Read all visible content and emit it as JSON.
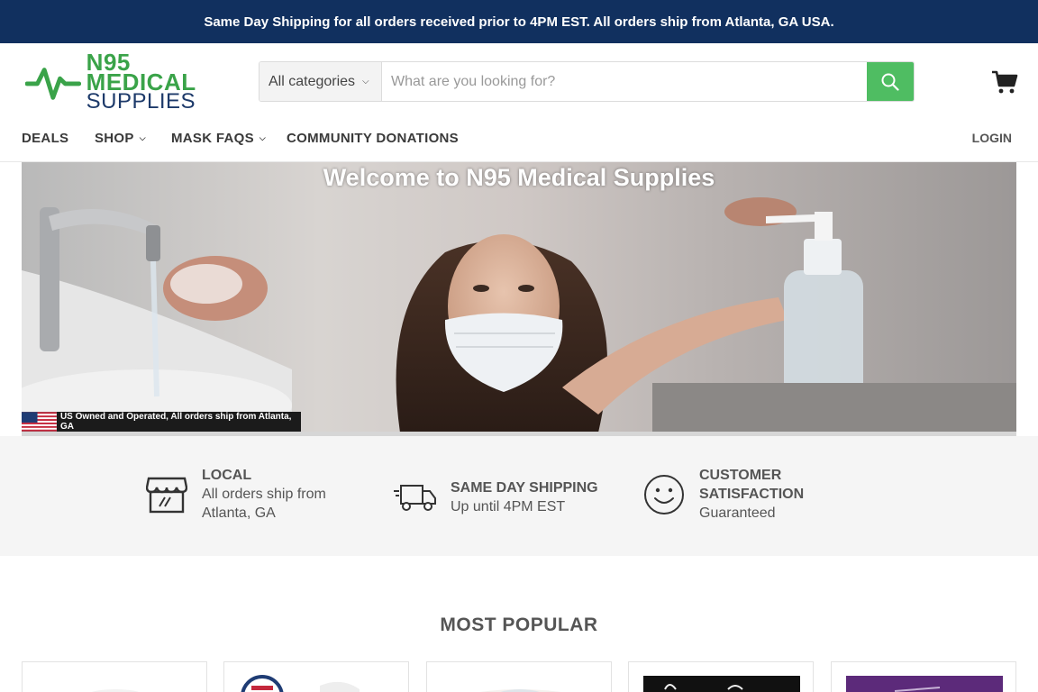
{
  "announcement": "Same Day Shipping for all orders received prior to 4PM EST. All orders ship from Atlanta, GA USA.",
  "logo": {
    "line1": "N95 MEDICAL",
    "line2": "SUPPLIES"
  },
  "search": {
    "category": "All categories",
    "placeholder": "What are you looking for?"
  },
  "nav": {
    "items": [
      {
        "label": "DEALS",
        "has_dropdown": false
      },
      {
        "label": "SHOP",
        "has_dropdown": true
      },
      {
        "label": "MASK FAQS",
        "has_dropdown": true
      },
      {
        "label": "COMMUNITY DONATIONS",
        "has_dropdown": false
      }
    ],
    "login": "LOGIN"
  },
  "hero": {
    "title": "Welcome to N95 Medical Supplies",
    "strip": "US Owned and Operated, All orders ship from Atlanta, GA"
  },
  "features": [
    {
      "icon": "storefront-icon",
      "title": "LOCAL",
      "sub": "All orders ship from Atlanta, GA"
    },
    {
      "icon": "delivery-truck-icon",
      "title": "SAME DAY SHIPPING",
      "sub": "Up until 4PM EST"
    },
    {
      "icon": "smiley-face-icon",
      "title": "CUSTOMER SATISFACTION",
      "sub": "Guaranteed"
    }
  ],
  "popular": {
    "title": "MOST POPULAR"
  },
  "colors": {
    "announce_bg": "#11305f",
    "brand_green": "#3aa349",
    "brand_navy": "#1d3a6a",
    "search_btn": "#4fbd62"
  }
}
